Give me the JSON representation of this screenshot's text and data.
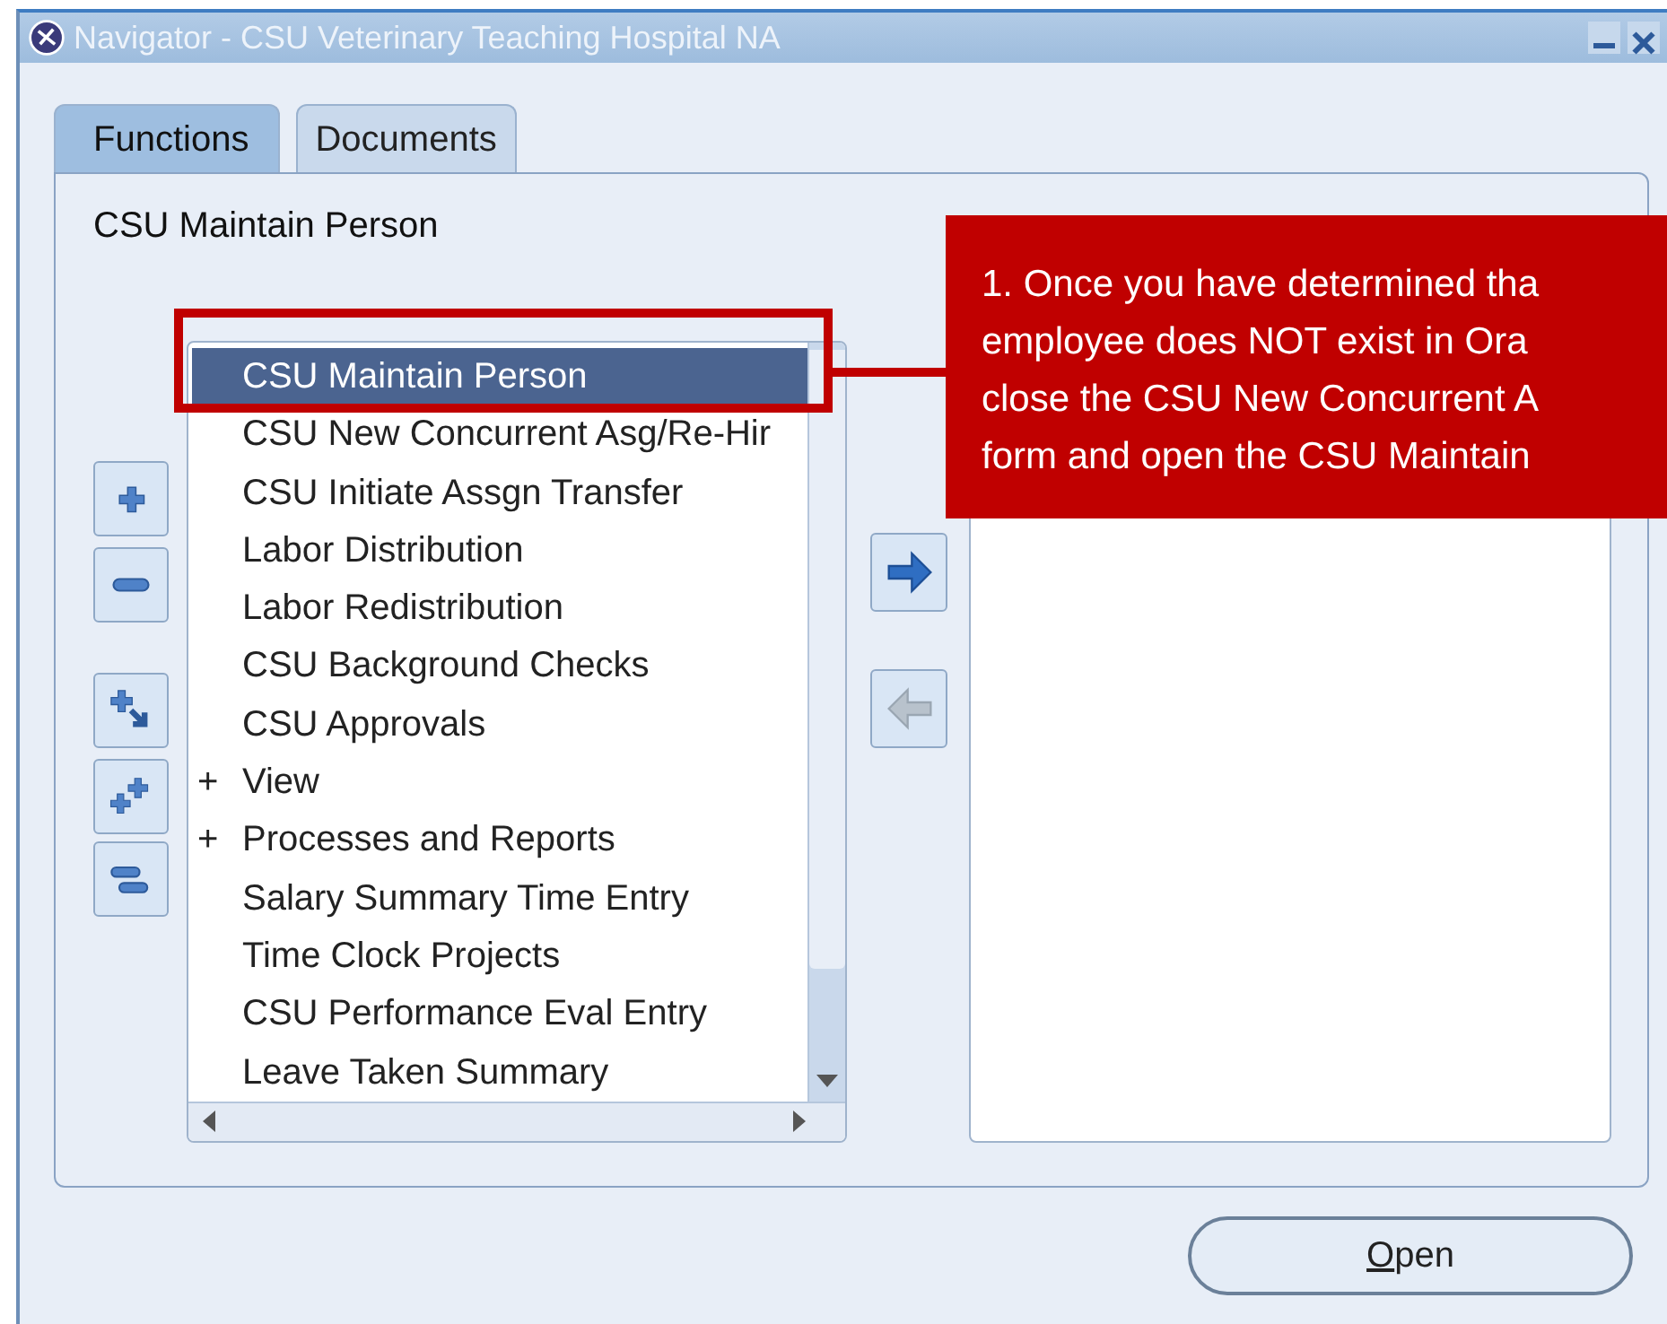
{
  "window": {
    "title": "Navigator - CSU Veterinary Teaching Hospital NA"
  },
  "tabs": [
    {
      "label": "Functions",
      "selected": true
    },
    {
      "label": "Documents",
      "selected": false
    }
  ],
  "current_function": "CSU Maintain Person",
  "functions": [
    {
      "label": "CSU Maintain Person",
      "selected": true
    },
    {
      "label": "CSU New Concurrent Asg/Re-Hir",
      "selected": false
    },
    {
      "label": "CSU Initiate Assgn Transfer",
      "selected": false
    },
    {
      "label": "Labor Distribution",
      "selected": false
    },
    {
      "label": "Labor Redistribution",
      "selected": false
    },
    {
      "label": "CSU Background Checks",
      "selected": false
    },
    {
      "label": "CSU Approvals",
      "selected": false
    },
    {
      "label": "View",
      "marker": "+",
      "selected": false
    },
    {
      "label": "Processes and Reports",
      "marker": "+",
      "selected": false
    },
    {
      "label": "Salary Summary Time Entry",
      "selected": false
    },
    {
      "label": "Time Clock Projects",
      "selected": false
    },
    {
      "label": "CSU Performance Eval Entry",
      "selected": false
    },
    {
      "label": "Leave Taken Summary",
      "selected": false
    }
  ],
  "tree_buttons": [
    {
      "kind": "expand"
    },
    {
      "kind": "collapse"
    },
    {
      "kind": "expand-branch"
    },
    {
      "kind": "expand-all"
    },
    {
      "kind": "collapse-all"
    }
  ],
  "transfer_buttons": [
    {
      "kind": "add",
      "disabled": false
    },
    {
      "kind": "remove",
      "disabled": true
    }
  ],
  "open_button": {
    "label": "Open"
  },
  "callout": {
    "lines": [
      "1. Once you have determined tha",
      "employee does NOT exist in Ora",
      "close the CSU New Concurrent A",
      "form and open the CSU Maintain"
    ]
  }
}
